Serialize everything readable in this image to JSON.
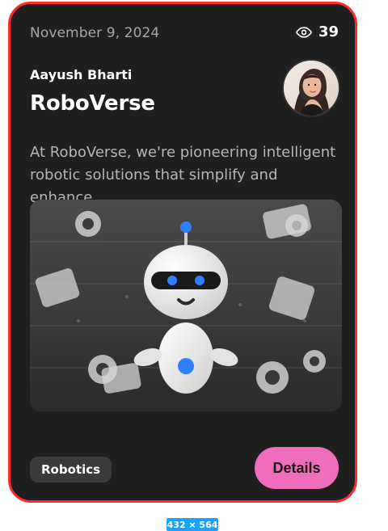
{
  "card": {
    "date": "November 9, 2024",
    "views": "39",
    "author": "Aayush Bharti",
    "title": "RoboVerse",
    "description": "At RoboVerse, we're pioneering intelligent robotic solutions that simplify and enhance...",
    "tag": "Robotics",
    "details_label": "Details"
  },
  "footer": {
    "dimensions": "432 × 564"
  },
  "colors": {
    "card_background": "#1f1f20",
    "card_border": "#ff2a2a",
    "details_button": "#f06dbb",
    "tag_background": "#3a3a3a",
    "dimension_badge": "#1aa3ff"
  },
  "icons": {
    "views": "eye-icon"
  }
}
